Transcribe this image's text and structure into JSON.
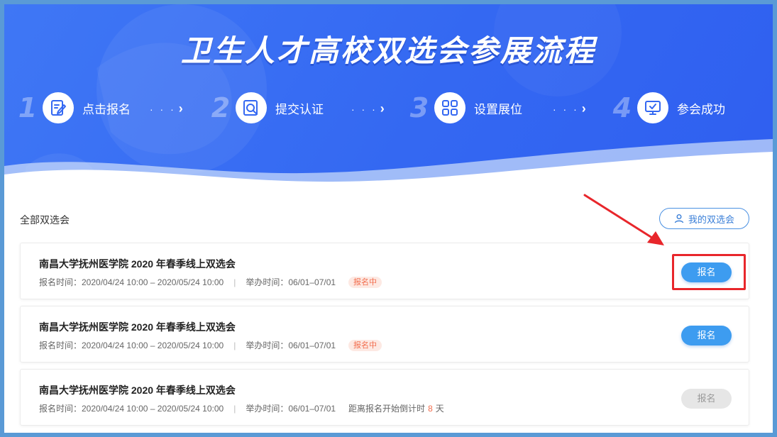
{
  "hero": {
    "title": "卫生人才高校双选会参展流程",
    "steps": [
      {
        "num": "1",
        "label": "点击报名",
        "icon": "edit-icon"
      },
      {
        "num": "2",
        "label": "提交认证",
        "icon": "search-doc-icon"
      },
      {
        "num": "3",
        "label": "设置展位",
        "icon": "grid-icon"
      },
      {
        "num": "4",
        "label": "参会成功",
        "icon": "monitor-check-icon"
      }
    ],
    "arrow_dots": "· · ·",
    "arrow_chevron": "›"
  },
  "list": {
    "section_title": "全部双选会",
    "my_button_label": "我的双选会",
    "cards": [
      {
        "title": "南昌大学抚州医学院 2020 年春季线上双选会",
        "signup_time": "报名时间：2020/04/24 10:00 – 2020/05/24 10:00",
        "separator": "|",
        "held_time": "举办时间：06/01–07/01",
        "status": "报名中",
        "button": "报名"
      },
      {
        "title": "南昌大学抚州医学院 2020 年春季线上双选会",
        "signup_time": "报名时间：2020/04/24 10:00 – 2020/05/24 10:00",
        "separator": "|",
        "held_time": "举办时间：06/01–07/01",
        "status": "报名中",
        "button": "报名"
      },
      {
        "title": "南昌大学抚州医学院 2020 年春季线上双选会",
        "signup_time": "报名时间：2020/04/24 10:00 – 2020/05/24 10:00",
        "separator": "|",
        "held_time": "举办时间：06/01–07/01",
        "countdown_prefix": "距离报名开始倒计时",
        "countdown_value": "8",
        "countdown_unit": "天",
        "button": "报名"
      }
    ]
  },
  "colors": {
    "hero_blue": "#3468f2",
    "button_blue": "#3d9cf0",
    "status_orange": "#f26d4d",
    "annotation_red": "#e8262b",
    "disabled_gray": "#e6e6e6"
  }
}
